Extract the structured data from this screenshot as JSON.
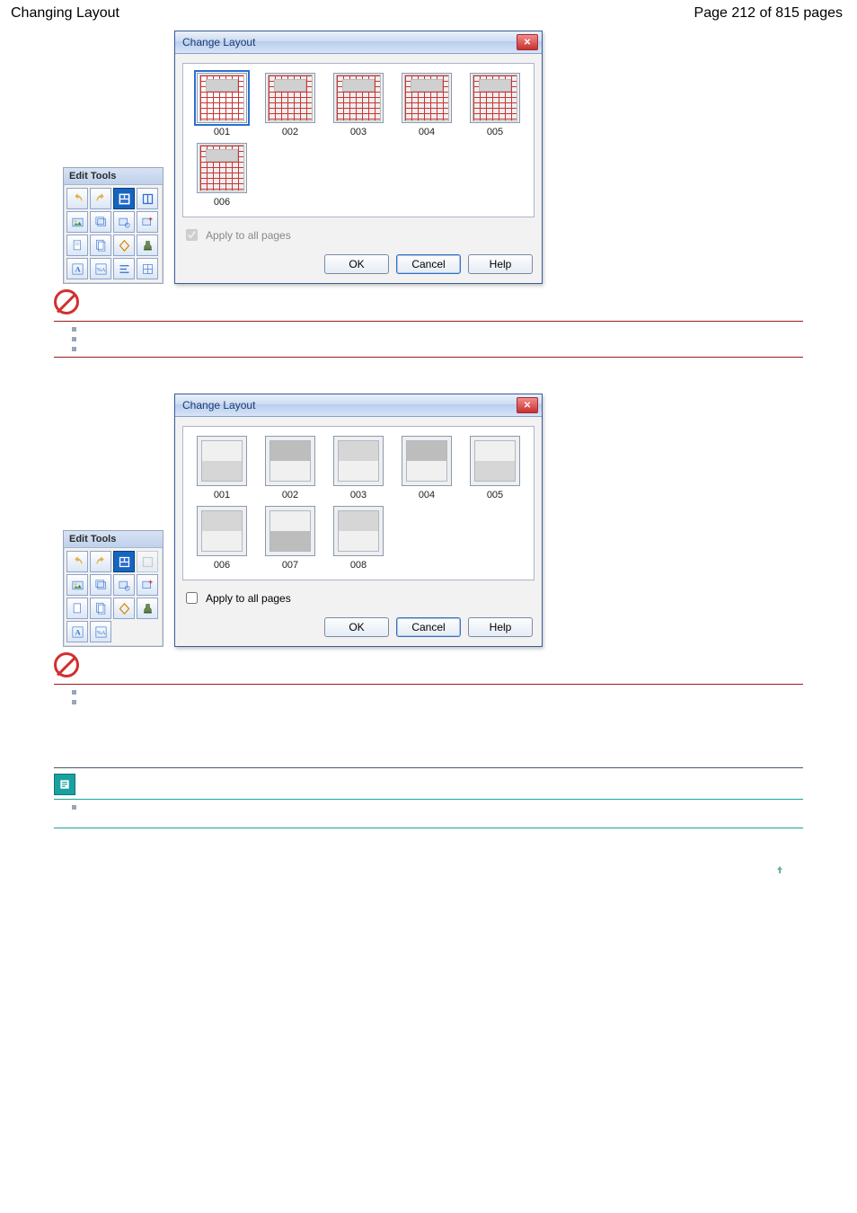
{
  "header": {
    "title": "Changing Layout",
    "page_indicator": "Page 212 of 815 pages"
  },
  "edit_tools_title": "Edit Tools",
  "dialog": {
    "title": "Change Layout",
    "apply_label": "Apply to all pages",
    "ok": "OK",
    "cancel": "Cancel",
    "help": "Help"
  },
  "dialog1": {
    "apply_checked": true,
    "apply_disabled": true,
    "selected_index": 0,
    "thumbs": [
      {
        "id": "001"
      },
      {
        "id": "002"
      },
      {
        "id": "003"
      },
      {
        "id": "004"
      },
      {
        "id": "005"
      },
      {
        "id": "006"
      }
    ]
  },
  "dialog2": {
    "apply_checked": false,
    "apply_disabled": false,
    "selected_index": -1,
    "thumbs": [
      {
        "id": "001"
      },
      {
        "id": "002"
      },
      {
        "id": "003"
      },
      {
        "id": "004"
      },
      {
        "id": "005"
      },
      {
        "id": "006"
      },
      {
        "id": "007"
      },
      {
        "id": "008"
      }
    ]
  },
  "bullets1_count": 3,
  "bullets2_count": 2,
  "bullets3_count": 1
}
